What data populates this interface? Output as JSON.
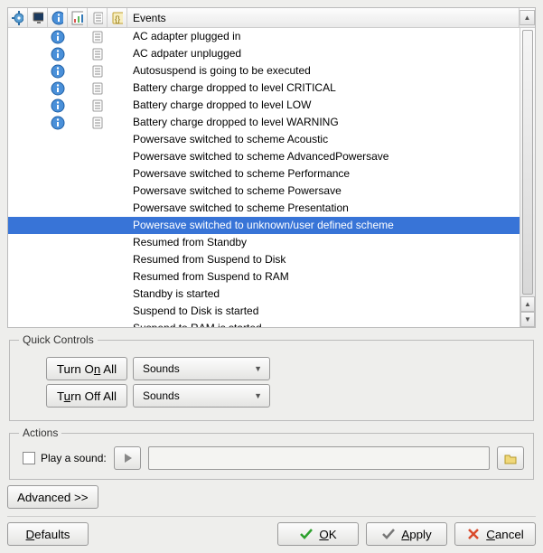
{
  "colors": {
    "selection": "#3874d7",
    "panel": "#eeeeec"
  },
  "header": {
    "title": "Events",
    "icon_cols": [
      "gear-icon",
      "monitor-icon",
      "info-icon",
      "chart-icon",
      "log-icon",
      "script-icon"
    ]
  },
  "events": [
    {
      "name": "AC adapter plugged in",
      "icons": {
        "info": true,
        "log": true
      },
      "selected": false
    },
    {
      "name": "AC adpater unplugged",
      "icons": {
        "info": true,
        "log": true
      },
      "selected": false
    },
    {
      "name": "Autosuspend is going to be executed",
      "icons": {
        "info": true,
        "log": true
      },
      "selected": false
    },
    {
      "name": "Battery charge dropped to level CRITICAL",
      "icons": {
        "info": true,
        "log": true
      },
      "selected": false
    },
    {
      "name": "Battery charge dropped to level LOW",
      "icons": {
        "info": true,
        "log": true
      },
      "selected": false
    },
    {
      "name": "Battery charge dropped to level WARNING",
      "icons": {
        "info": true,
        "log": true
      },
      "selected": false
    },
    {
      "name": "Powersave switched to scheme Acoustic",
      "icons": {},
      "selected": false
    },
    {
      "name": "Powersave switched to scheme AdvancedPowersave",
      "icons": {},
      "selected": false
    },
    {
      "name": "Powersave switched to scheme Performance",
      "icons": {},
      "selected": false
    },
    {
      "name": "Powersave switched to scheme Powersave",
      "icons": {},
      "selected": false
    },
    {
      "name": "Powersave switched to scheme Presentation",
      "icons": {},
      "selected": false
    },
    {
      "name": "Powersave switched to unknown/user defined scheme",
      "icons": {},
      "selected": true
    },
    {
      "name": "Resumed from Standby",
      "icons": {},
      "selected": false
    },
    {
      "name": "Resumed from Suspend to Disk",
      "icons": {},
      "selected": false
    },
    {
      "name": "Resumed from Suspend to RAM",
      "icons": {},
      "selected": false
    },
    {
      "name": "Standby is started",
      "icons": {},
      "selected": false
    },
    {
      "name": "Suspend to Disk is started",
      "icons": {},
      "selected": false
    },
    {
      "name": "Suspend to RAM is started",
      "icons": {},
      "selected": false
    }
  ],
  "quick_controls": {
    "legend": "Quick Controls",
    "on_all": "Turn On All",
    "off_all": "Turn Off All",
    "select_on": "Sounds",
    "select_off": "Sounds"
  },
  "actions": {
    "legend": "Actions",
    "play_label": "Play a sound:",
    "path": ""
  },
  "buttons": {
    "advanced": "Advanced >>",
    "defaults": "Defaults",
    "ok_pre": "",
    "ok_accel": "O",
    "ok_post": "K",
    "apply_pre": "",
    "apply_accel": "A",
    "apply_post": "pply",
    "cancel_pre": "",
    "cancel_accel": "C",
    "cancel_post": "ancel"
  }
}
